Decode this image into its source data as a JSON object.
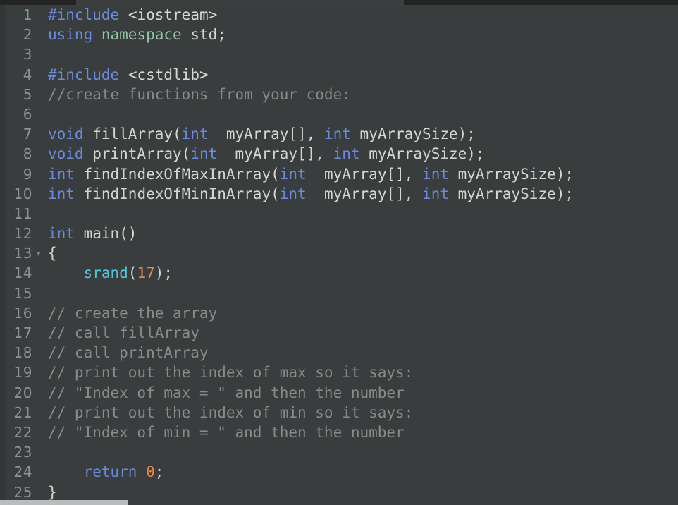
{
  "window": {
    "tab_strip_visible": true,
    "active_tab_accent": "#3c3d3f",
    "tab_strip_bg": "#232323"
  },
  "editor": {
    "background": "#3a3d3d",
    "gutter_color": "#8b9396",
    "default_text_color": "#d6d6d0",
    "language": "C++",
    "fold_marker": "▾",
    "fold_marker_line": 13,
    "scrollbar": {
      "orientation": "horizontal",
      "thumb_color": "#b9bcbc"
    },
    "palette": {
      "keyword": "#6a8ada",
      "namespace": "#93c6a4",
      "function": "#55c5d6",
      "number": "#e8864a",
      "comment": "#878c8a",
      "plain": "#d6d6d0"
    },
    "lines": [
      {
        "n": "1",
        "tokens": [
          {
            "t": "#include",
            "c": "k"
          },
          {
            "t": " ",
            "c": "pl"
          },
          {
            "t": "<iostream>",
            "c": "inc"
          }
        ]
      },
      {
        "n": "2",
        "tokens": [
          {
            "t": "using",
            "c": "k"
          },
          {
            "t": " ",
            "c": "pl"
          },
          {
            "t": "namespace",
            "c": "ns"
          },
          {
            "t": " std;",
            "c": "pl"
          }
        ]
      },
      {
        "n": "3",
        "tokens": []
      },
      {
        "n": "4",
        "tokens": [
          {
            "t": "#include",
            "c": "k"
          },
          {
            "t": " ",
            "c": "pl"
          },
          {
            "t": "<cstdlib>",
            "c": "inc"
          }
        ]
      },
      {
        "n": "5",
        "tokens": [
          {
            "t": "//create functions from your code:",
            "c": "cm"
          }
        ]
      },
      {
        "n": "6",
        "tokens": []
      },
      {
        "n": "7",
        "tokens": [
          {
            "t": "void",
            "c": "k"
          },
          {
            "t": " fillArray(",
            "c": "pl"
          },
          {
            "t": "int",
            "c": "k"
          },
          {
            "t": "  myArray[], ",
            "c": "pl"
          },
          {
            "t": "int",
            "c": "k"
          },
          {
            "t": " myArraySize);",
            "c": "pl"
          }
        ]
      },
      {
        "n": "8",
        "tokens": [
          {
            "t": "void",
            "c": "k"
          },
          {
            "t": " printArray(",
            "c": "pl"
          },
          {
            "t": "int",
            "c": "k"
          },
          {
            "t": "  myArray[], ",
            "c": "pl"
          },
          {
            "t": "int",
            "c": "k"
          },
          {
            "t": " myArraySize);",
            "c": "pl"
          }
        ]
      },
      {
        "n": "9",
        "tokens": [
          {
            "t": "int",
            "c": "k"
          },
          {
            "t": " findIndexOfMaxInArray(",
            "c": "pl"
          },
          {
            "t": "int",
            "c": "k"
          },
          {
            "t": "  myArray[], ",
            "c": "pl"
          },
          {
            "t": "int",
            "c": "k"
          },
          {
            "t": " myArraySize);",
            "c": "pl"
          }
        ]
      },
      {
        "n": "10",
        "tokens": [
          {
            "t": "int",
            "c": "k"
          },
          {
            "t": " findIndexOfMinInArray(",
            "c": "pl"
          },
          {
            "t": "int",
            "c": "k"
          },
          {
            "t": "  myArray[], ",
            "c": "pl"
          },
          {
            "t": "int",
            "c": "k"
          },
          {
            "t": " myArraySize);",
            "c": "pl"
          }
        ]
      },
      {
        "n": "11",
        "tokens": []
      },
      {
        "n": "12",
        "tokens": [
          {
            "t": "int",
            "c": "k"
          },
          {
            "t": " main()",
            "c": "pl"
          }
        ]
      },
      {
        "n": "13",
        "tokens": [
          {
            "t": "{",
            "c": "pl"
          }
        ],
        "fold": true
      },
      {
        "n": "14",
        "tokens": [
          {
            "t": "    ",
            "c": "pl"
          },
          {
            "t": "srand",
            "c": "fn"
          },
          {
            "t": "(",
            "c": "pl"
          },
          {
            "t": "17",
            "c": "num"
          },
          {
            "t": ");",
            "c": "pl"
          }
        ]
      },
      {
        "n": "15",
        "tokens": []
      },
      {
        "n": "16",
        "tokens": [
          {
            "t": "// create the array",
            "c": "cm"
          }
        ]
      },
      {
        "n": "17",
        "tokens": [
          {
            "t": "// call fillArray",
            "c": "cm"
          }
        ]
      },
      {
        "n": "18",
        "tokens": [
          {
            "t": "// call printArray",
            "c": "cm"
          }
        ]
      },
      {
        "n": "19",
        "tokens": [
          {
            "t": "// print out the index of max so it says:",
            "c": "cm"
          }
        ]
      },
      {
        "n": "20",
        "tokens": [
          {
            "t": "// \"Index of max = \" and then the number",
            "c": "cm"
          }
        ]
      },
      {
        "n": "21",
        "tokens": [
          {
            "t": "// print out the index of min so it says:",
            "c": "cm"
          }
        ]
      },
      {
        "n": "22",
        "tokens": [
          {
            "t": "// \"Index of min = \" and then the number",
            "c": "cm"
          }
        ]
      },
      {
        "n": "23",
        "tokens": []
      },
      {
        "n": "24",
        "tokens": [
          {
            "t": "    ",
            "c": "pl"
          },
          {
            "t": "return",
            "c": "k"
          },
          {
            "t": " ",
            "c": "pl"
          },
          {
            "t": "0",
            "c": "num"
          },
          {
            "t": ";",
            "c": "pl"
          }
        ]
      },
      {
        "n": "25",
        "tokens": [
          {
            "t": "}",
            "c": "pl"
          }
        ]
      }
    ]
  }
}
